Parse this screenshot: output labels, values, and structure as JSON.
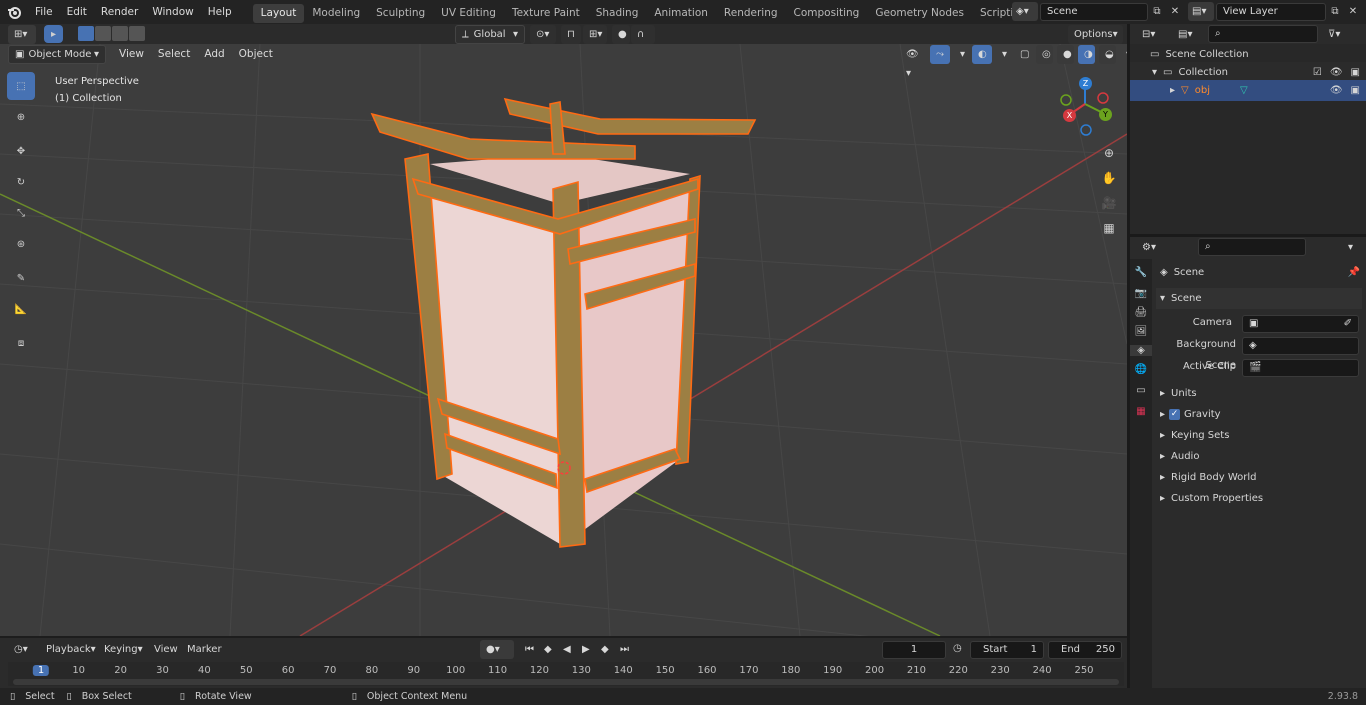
{
  "menu": [
    "File",
    "Edit",
    "Render",
    "Window",
    "Help"
  ],
  "workspaces": [
    "Layout",
    "Modeling",
    "Sculpting",
    "UV Editing",
    "Texture Paint",
    "Shading",
    "Animation",
    "Rendering",
    "Compositing",
    "Geometry Nodes",
    "Scripting"
  ],
  "scene_field": "Scene",
  "view_layer_field": "View Layer",
  "viewport_header": {
    "mode": "Object Mode",
    "menus": [
      "View",
      "Select",
      "Add",
      "Object"
    ],
    "orientation": "Global",
    "options": "Options"
  },
  "viewport_overlay": {
    "perspective": "User Perspective",
    "collection": "(1) Collection"
  },
  "gizmo": {
    "z": "Z",
    "y": "Y",
    "x": "X"
  },
  "outliner": {
    "scene_collection": "Scene Collection",
    "collection": "Collection",
    "object": "obj"
  },
  "properties": {
    "title": "Scene",
    "panel": "Scene",
    "camera_label": "Camera",
    "background_label": "Background Scene",
    "clip_label": "Active Clip",
    "sections": [
      "Units",
      "Gravity",
      "Keying Sets",
      "Audio",
      "Rigid Body World",
      "Custom Properties"
    ]
  },
  "timeline": {
    "menus": [
      "Playback",
      "Keying",
      "View",
      "Marker"
    ],
    "current_frame": "1",
    "start_label": "Start",
    "start": "1",
    "end_label": "End",
    "end": "250",
    "ticks": [
      "1",
      "10",
      "20",
      "30",
      "40",
      "50",
      "60",
      "70",
      "80",
      "90",
      "100",
      "110",
      "120",
      "130",
      "140",
      "150",
      "160",
      "170",
      "180",
      "190",
      "200",
      "210",
      "220",
      "230",
      "240",
      "250"
    ]
  },
  "status": {
    "select": "Select",
    "box_select": "Box Select",
    "rotate": "Rotate View",
    "context": "Object Context Menu",
    "version": "2.93.8"
  },
  "colors": {
    "accent": "#4772b3",
    "selection_outline": "#ff6a13",
    "lamp_wood": "#9c7f43",
    "lamp_paper": "#ecd6d4"
  }
}
